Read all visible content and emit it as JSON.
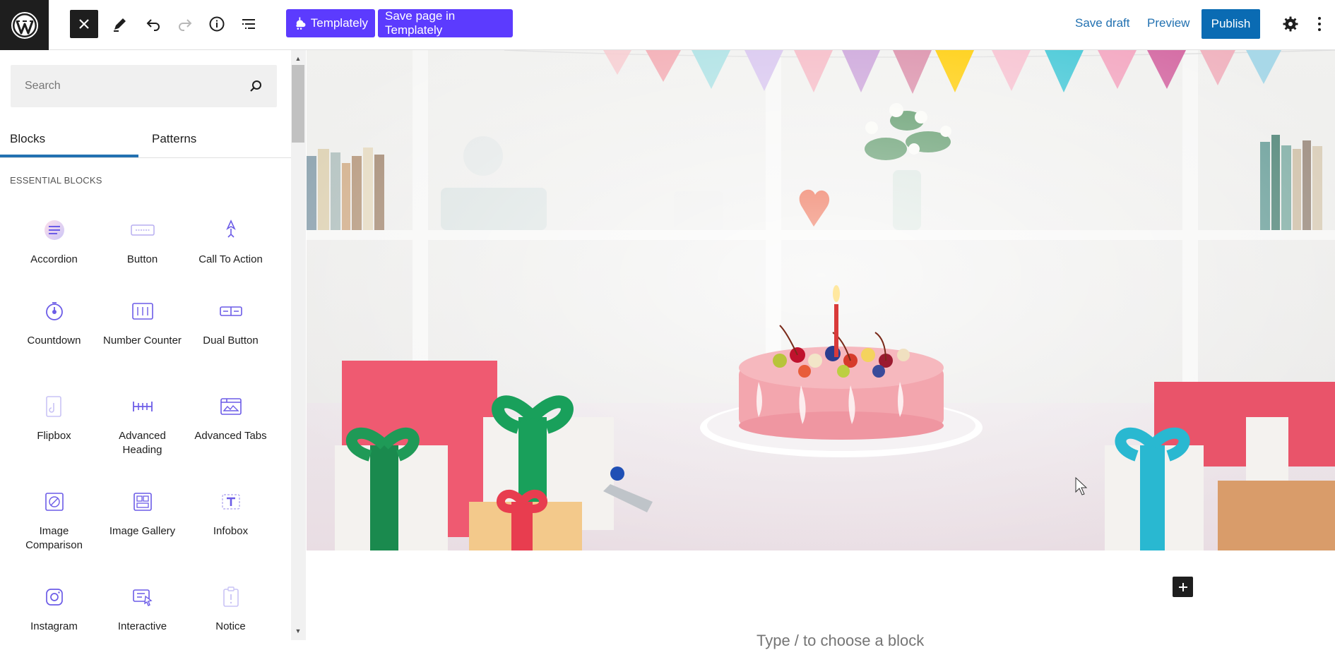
{
  "topbar": {
    "templately_label": "Templately",
    "save_in_templately_label": "Save page in Templately",
    "save_draft_label": "Save draft",
    "preview_label": "Preview",
    "publish_label": "Publish"
  },
  "sidebar": {
    "search_placeholder": "Search",
    "tabs": [
      {
        "label": "Blocks"
      },
      {
        "label": "Patterns"
      }
    ],
    "section_title": "ESSENTIAL BLOCKS",
    "blocks": [
      {
        "label": "Accordion",
        "icon": "accordion-icon"
      },
      {
        "label": "Button",
        "icon": "button-icon"
      },
      {
        "label": "Call To Action",
        "icon": "call-to-action-icon"
      },
      {
        "label": "Countdown",
        "icon": "countdown-icon"
      },
      {
        "label": "Number Counter",
        "icon": "number-counter-icon"
      },
      {
        "label": "Dual Button",
        "icon": "dual-button-icon"
      },
      {
        "label": "Flipbox",
        "icon": "flipbox-icon"
      },
      {
        "label": "Advanced Heading",
        "icon": "advanced-heading-icon"
      },
      {
        "label": "Advanced Tabs",
        "icon": "advanced-tabs-icon"
      },
      {
        "label": "Image Comparison",
        "icon": "image-comparison-icon"
      },
      {
        "label": "Image Gallery",
        "icon": "image-gallery-icon"
      },
      {
        "label": "Infobox",
        "icon": "infobox-icon"
      },
      {
        "label": "Instagram",
        "icon": "instagram-icon"
      },
      {
        "label": "Interactive",
        "icon": "interactive-icon"
      },
      {
        "label": "Notice",
        "icon": "notice-icon"
      }
    ]
  },
  "editor": {
    "placeholder": "Type / to choose a block"
  },
  "colors": {
    "accent": "#2271b1",
    "publish": "#0a6bb3",
    "templately": "#5c3bfe",
    "block_icon": "#6c5ce7"
  }
}
